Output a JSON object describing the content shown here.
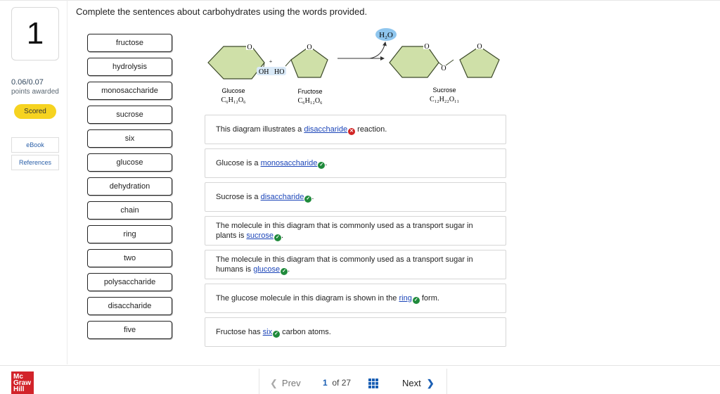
{
  "question": {
    "number": "1",
    "score": "0.06/0.07",
    "awarded_label": "points awarded",
    "status": "Scored",
    "instructions": "Complete the sentences about carbohydrates using the words provided."
  },
  "sidebar": {
    "ebook": "eBook",
    "references": "References"
  },
  "word_bank": [
    "fructose",
    "hydrolysis",
    "monosaccharide",
    "sucrose",
    "six",
    "glucose",
    "dehydration",
    "chain",
    "ring",
    "two",
    "polysaccharide",
    "disaccharide",
    "five"
  ],
  "diagram": {
    "water": "H₂O",
    "plus": "+",
    "oh": "OH",
    "ho": "HO",
    "ring_o": "O",
    "glucose_name": "Glucose",
    "glucose_formula": "C₆H₁₂O₆",
    "fructose_name": "Fructose",
    "fructose_formula": "C₆H₁₂O₆",
    "sucrose_name": "Sucrose",
    "sucrose_formula": "C₁₂H₂₂O₁₁"
  },
  "sentences": [
    {
      "before": "This diagram illustrates a ",
      "answer": "disaccharide",
      "correct": false,
      "after": " reaction."
    },
    {
      "before": "Glucose is a ",
      "answer": "monosaccharide",
      "correct": true,
      "after": "."
    },
    {
      "before": "Sucrose is a ",
      "answer": "disaccharide",
      "correct": true,
      "after": "."
    },
    {
      "before": "The molecule in this diagram that is commonly used as a transport sugar in plants is ",
      "answer": "sucrose",
      "correct": true,
      "after": "."
    },
    {
      "before": "The molecule in this diagram that is commonly used as a transport sugar in humans is ",
      "answer": "glucose",
      "correct": true,
      "after": "."
    },
    {
      "before": "The glucose molecule in this diagram is shown in the ",
      "answer": "ring",
      "correct": true,
      "after": " form."
    },
    {
      "before": "Fructose has ",
      "answer": "six",
      "correct": true,
      "after": " carbon atoms."
    }
  ],
  "footer": {
    "logo": "Mc Graw Hill",
    "prev": "Prev",
    "page_current": "1",
    "page_of": "of 27",
    "next": "Next"
  },
  "colors": {
    "ring_fill": "#cfe0a8",
    "ring_stroke": "#3d4a2a",
    "water_fill": "#8fc6ee",
    "correct": "#1f8a3b",
    "incorrect": "#d12424",
    "scored_badge": "#f6d320",
    "link": "#1a44b8"
  },
  "icons": {
    "prev": "chevron-left-icon",
    "next": "chevron-right-icon",
    "grid": "grid-icon",
    "correct": "check-circle-icon",
    "incorrect": "x-circle-icon"
  }
}
